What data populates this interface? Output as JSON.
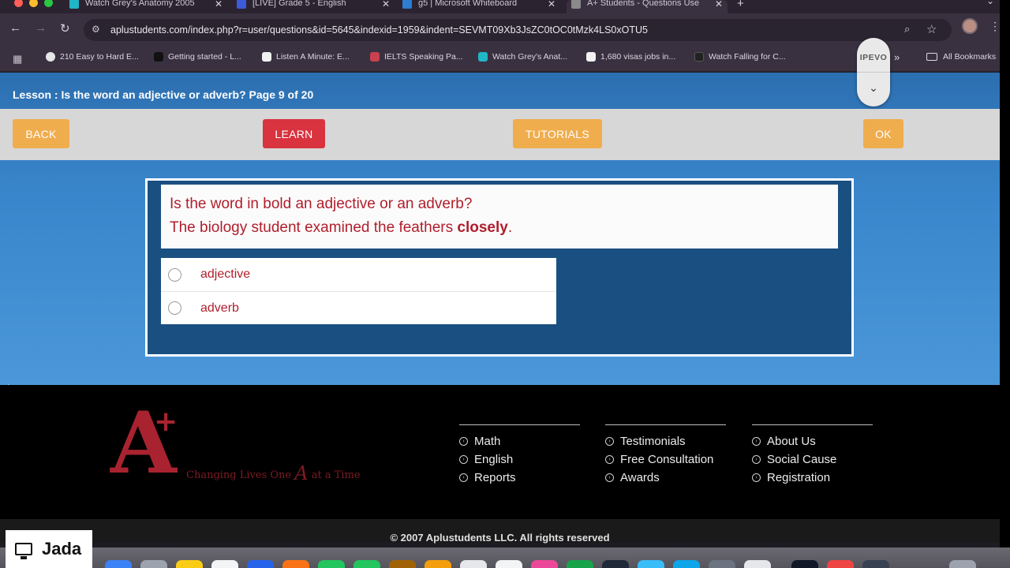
{
  "browser": {
    "tabs": [
      {
        "label": "Watch Grey's Anatomy 2005",
        "icon_color": "#1fb6c7",
        "active": false
      },
      {
        "label": "[LIVE] Grade 5 - English",
        "icon_color": "#3b5bdb",
        "active": false
      },
      {
        "label": "g5 | Microsoft Whiteboard",
        "icon_color": "#2d7dd2",
        "active": false
      },
      {
        "label": "A+ Students - Questions Use",
        "icon_color": "#8a8a8a",
        "active": true
      }
    ],
    "close_glyph": "✕",
    "new_tab_glyph": "+",
    "url": "aplustudents.com/index.php?r=user/questions&id=5645&indexid=1959&indent=SEVMT09Xb3JsZC0tOC0tMzk4LS0xOTU5",
    "bookmarks": [
      {
        "label": "210 Easy to Hard E...",
        "icon_color": "#e6e6e6"
      },
      {
        "label": "Getting started - L...",
        "icon_color": "#111111"
      },
      {
        "label": "Listen A Minute: E...",
        "icon_color": "#f2f2f2"
      },
      {
        "label": "IELTS Speaking Pa...",
        "icon_color": "#c9404e"
      },
      {
        "label": "Watch Grey's Anat...",
        "icon_color": "#1fb6c7"
      },
      {
        "label": "1,680 visas jobs in...",
        "icon_color": "#f2f2f2"
      },
      {
        "label": "Watch Falling for C...",
        "icon_color": "#222222"
      }
    ],
    "more_bookmarks": "»",
    "all_bookmarks": "All Bookmarks"
  },
  "ipevo": {
    "label": "IPEVO",
    "chevron": "⌄"
  },
  "lesson": {
    "title": "Lesson : Is the word an adjective or adverb? Page 9 of 20",
    "buttons": {
      "back": "BACK",
      "learn": "LEARN",
      "tutorials": "TUTORIALS",
      "ok": "OK"
    }
  },
  "question": {
    "prompt": "Is the word in bold an adjective or an adverb?",
    "sentence_before": "The biology student examined the feathers ",
    "sentence_bold": "closely",
    "sentence_after": ".",
    "options": [
      "adjective",
      "adverb"
    ]
  },
  "footer": {
    "logo_mark": "A",
    "logo_plus": "+",
    "tagline_before": "Changing Lives One ",
    "tagline_script": "A",
    "tagline_after": " at a Time",
    "columns": [
      [
        "Math",
        "English",
        "Reports"
      ],
      [
        "Testimonials",
        "Free Consultation",
        "Awards"
      ],
      [
        "About Us",
        "Social Cause",
        "Registration"
      ]
    ],
    "copyright": "© 2007 Aplustudents LLC. All rights reserved"
  },
  "overlay": {
    "presenter": "Jada"
  },
  "colors": {
    "accent_orange": "#f0ad4e",
    "accent_red": "#d9333f",
    "question_text": "#b01e2c",
    "page_blue": "#3a86cc"
  }
}
